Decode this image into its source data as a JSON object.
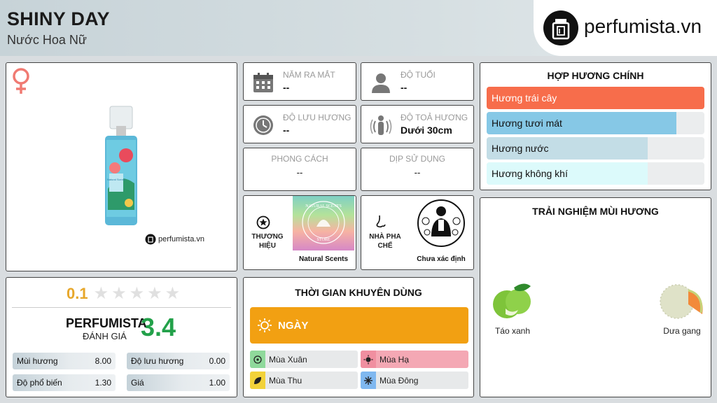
{
  "header": {
    "title": "SHINY DAY",
    "subtitle": "Nước Hoa Nữ",
    "logo_text": "perfumista.vn"
  },
  "product_image": {
    "watermark": "perfumista.vn",
    "bottle_text": "Natural Scents"
  },
  "rating": {
    "user_score": "0.1",
    "stars_total": 5,
    "perfumista_label": "PERFUMISTA",
    "perfumista_sub": "ĐÁNH GIÁ",
    "perfumista_score": "3.4",
    "metrics": [
      {
        "label": "Mùi hương",
        "value": "8.00"
      },
      {
        "label": "Độ lưu hương",
        "value": "0.00"
      },
      {
        "label": "Độ phổ biến",
        "value": "1.30"
      },
      {
        "label": "Giá",
        "value": "1.00"
      }
    ]
  },
  "info": {
    "release_year": {
      "label": "NĂM RA MẮT",
      "value": "--"
    },
    "age": {
      "label": "ĐỘ TUỔI",
      "value": "--"
    },
    "longevity": {
      "label": "ĐỘ LƯU HƯƠNG",
      "value": "--"
    },
    "sillage": {
      "label": "ĐỘ TOẢ HƯƠNG",
      "value": "Dưới 30cm"
    },
    "style": {
      "label": "PHONG CÁCH",
      "value": "--"
    },
    "occasion": {
      "label": "DỊP SỬ DỤNG",
      "value": "--"
    }
  },
  "brand": {
    "label_line1": "THƯƠNG",
    "label_line2": "HIỆU",
    "name": "Natural Scents",
    "logo_top_text": "NATURAL SCENTS",
    "logo_bottom_text": "STORE"
  },
  "perfumer": {
    "label_line1": "NHÀ PHA",
    "label_line2": "CHẾ",
    "name": "Chưa xác định"
  },
  "time": {
    "title": "THỜI GIAN KHUYÊN DÙNG",
    "day_label": "NGÀY",
    "seasons": [
      {
        "label": "Mùa Xuân",
        "color": "#8fd99b"
      },
      {
        "label": "Mùa Hạ",
        "color": "#f08fa0"
      },
      {
        "label": "Mùa Thu",
        "color": "#f2d23a"
      },
      {
        "label": "Mùa Đông",
        "color": "#7fb8f0"
      }
    ]
  },
  "accords": {
    "title": "HỢP HƯƠNG CHÍNH",
    "items": [
      {
        "label": "Hương trái cây",
        "level": 1.0,
        "color": "#f76d4b",
        "text_color": "#ffffff"
      },
      {
        "label": "Hương tươi mát",
        "level": 0.87,
        "color": "#86c8e6",
        "text_color": "#111111"
      },
      {
        "label": "Hương nước",
        "level": 0.74,
        "color": "#c3dde6",
        "text_color": "#111111"
      },
      {
        "label": "Hương không khí",
        "level": 0.74,
        "color": "#dcfafb",
        "text_color": "#111111"
      }
    ]
  },
  "experience": {
    "title": "TRẢI NGHIỆM MÙI HƯƠNG",
    "notes": [
      {
        "label": "Táo xanh",
        "icon": "green-apple-icon"
      },
      {
        "label": "Dưa gang",
        "icon": "melon-icon"
      }
    ]
  }
}
